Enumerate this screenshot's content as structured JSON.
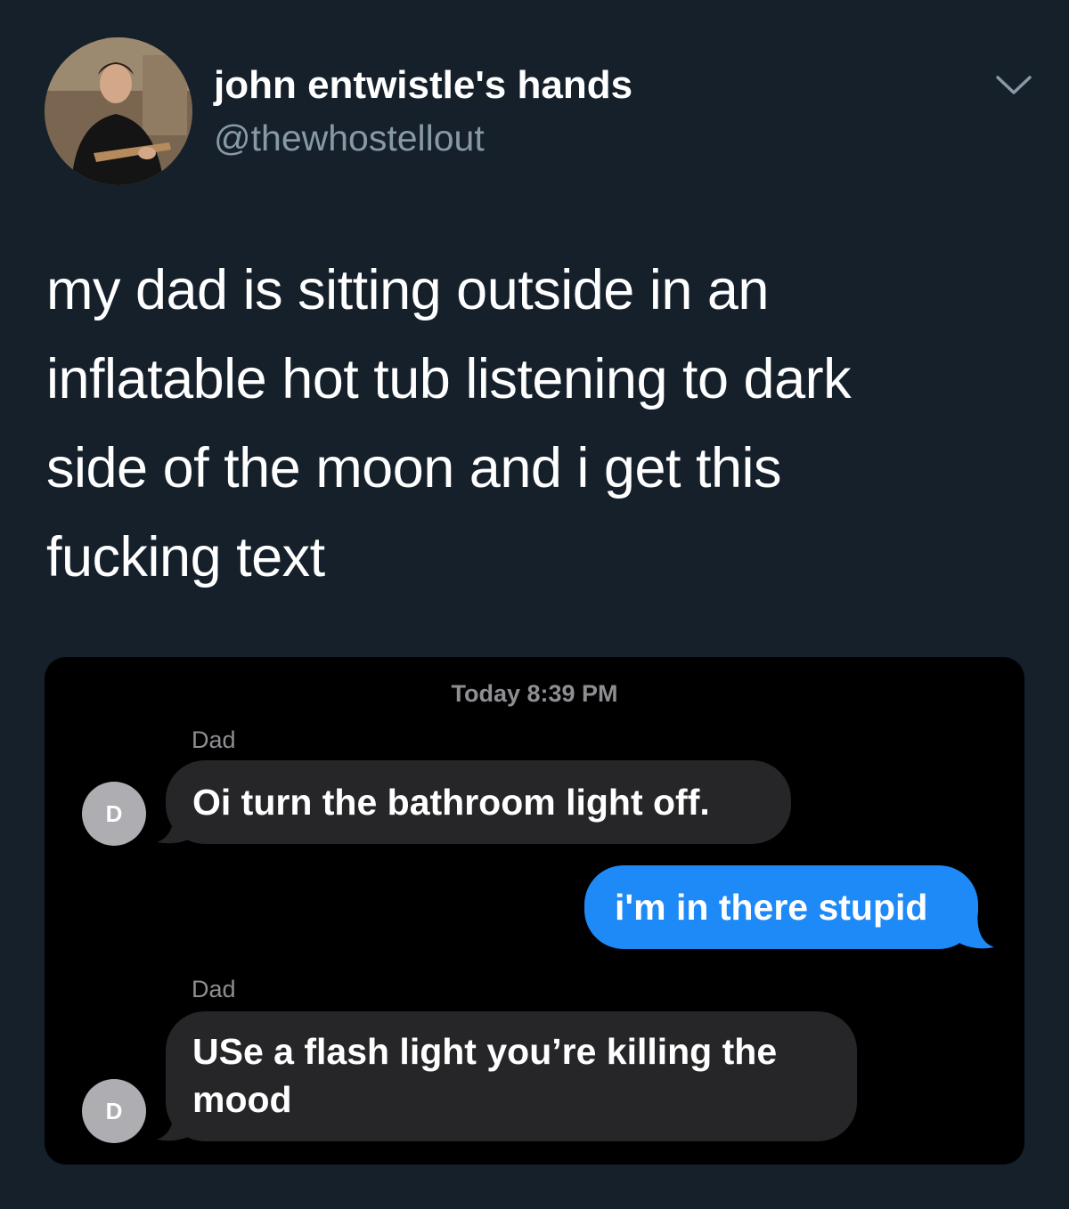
{
  "tweet": {
    "display_name": "john entwistle's hands",
    "handle": "@thewhostellout",
    "text": "my dad is sitting outside in an\ninflatable hot tub listening to dark\nside of the moon and i get this\nfucking text",
    "icons": {
      "avatar": "profile-photo",
      "menu": "chevron-down-icon"
    }
  },
  "screenshot": {
    "timestamp": "Today 8:39 PM",
    "messages": [
      {
        "sender": "Dad",
        "avatar_initial": "D",
        "direction": "incoming",
        "text": "Oi turn the bathroom light off."
      },
      {
        "sender": "",
        "direction": "outgoing",
        "text": "i'm in there stupid"
      },
      {
        "sender": "Dad",
        "avatar_initial": "D",
        "direction": "incoming",
        "text": "USe a flash light you’re killing the\nmood"
      }
    ],
    "colors": {
      "incoming_bubble": "#262628",
      "outgoing_bubble": "#1e8af8",
      "background": "#000000"
    }
  },
  "colors": {
    "page_background": "#15202b",
    "handle_text": "#8899a6"
  }
}
